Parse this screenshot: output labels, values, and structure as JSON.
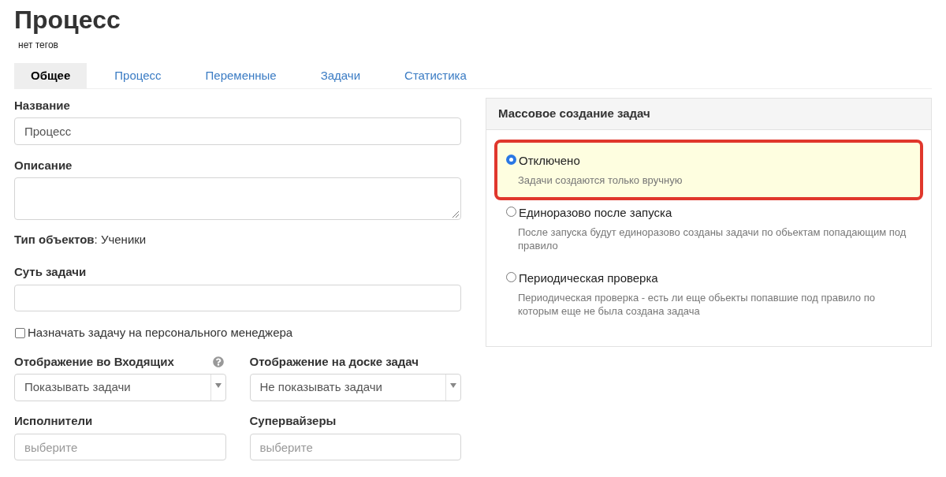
{
  "header": {
    "title": "Процесс",
    "tags": "нет тегов"
  },
  "tabs": [
    {
      "label": "Общее",
      "selected": true
    },
    {
      "label": "Процесс",
      "selected": false
    },
    {
      "label": "Переменные",
      "selected": false
    },
    {
      "label": "Задачи",
      "selected": false
    },
    {
      "label": "Статистика",
      "selected": false
    }
  ],
  "form": {
    "name": {
      "label": "Название",
      "value": "Процесс"
    },
    "description": {
      "label": "Описание"
    },
    "object_type": "**Тип объектов**: Ученики",
    "task_summary": {
      "label": "Суть задачи"
    },
    "assign_to_manager": {
      "label": "Назначать задачу на персонального менеджера",
      "checked": false
    },
    "inbox_display": {
      "label": "Отображение во Входящих",
      "value": "Показывать задачи"
    },
    "board_display": {
      "label": "Отображение на доске задач",
      "value": "Не показывать задачи"
    },
    "executors": {
      "label": "Исполнители",
      "placeholder": "выберите"
    },
    "supervisors": {
      "label": "Супервайзеры",
      "placeholder": "выберите"
    }
  },
  "mass_creation": {
    "title": "Массовое создание задач",
    "options": [
      {
        "label": "Отключено",
        "description": "Задачи создаются только вручную",
        "selected": true,
        "highlighted": true
      },
      {
        "label": "Единоразово после запуска",
        "description": "После запуска будут единоразово созданы задачи по обьектам попадающим под правило",
        "selected": false,
        "highlighted": false
      },
      {
        "label": "Периодическая проверка",
        "description": "Периодическая проверка - есть ли еще обьекты попавшие под правило по которым еще не была создана задача",
        "selected": false,
        "highlighted": false
      }
    ]
  }
}
